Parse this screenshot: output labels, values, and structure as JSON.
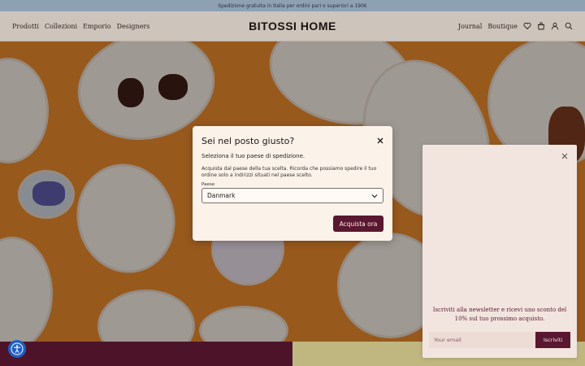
{
  "announcement": {
    "text": "Spedizione gratuita in Italia per ordini pari o superiori a 190€"
  },
  "header": {
    "logo": "BITOSSI HOME",
    "nav_left": [
      "Prodotti",
      "Collezioni",
      "Emporio",
      "Designers"
    ],
    "nav_right": [
      "Journal",
      "Boutique"
    ],
    "icons": [
      "heart-icon",
      "bag-icon",
      "user-icon",
      "search-icon"
    ]
  },
  "modal": {
    "title": "Sei nel posto giusto?",
    "subtitle": "Seleziona il tuo paese di spedizione.",
    "body": "Acquista dal paese della tua scelta. Ricorda che possiamo spedire il tuo ordine solo a indirizzi situati nel paese scelto.",
    "field_label": "Paese",
    "selected_country": "Danmark",
    "cta": "Acquista ora"
  },
  "newsletter": {
    "text": "Iscriviti alla newsletter e ricevi uno sconto del 10% sul tuo prossimo acquisto.",
    "placeholder": "Your email",
    "button": "Iscriviti"
  },
  "colors": {
    "accent": "#5a1730",
    "announcement_bg": "#a8c2d8",
    "header_bg": "#f6ede2",
    "hero_bg": "#e88a2c",
    "accessibility": "#1f5fc4"
  }
}
